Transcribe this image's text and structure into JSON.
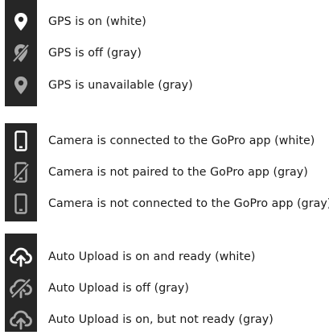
{
  "colors": {
    "icon_background": "#262626",
    "icon_white": "#ffffff",
    "icon_gray": "#a8a8a8",
    "text": "#1a1a1a"
  },
  "gps": {
    "items": [
      {
        "icon": "location-pin-icon",
        "label": "GPS is on (white)"
      },
      {
        "icon": "location-pin-off-icon",
        "label": "GPS is off (gray)"
      },
      {
        "icon": "location-pin-icon",
        "label": "GPS is unavailable (gray)"
      }
    ]
  },
  "app": {
    "items": [
      {
        "icon": "phone-icon",
        "label": "Camera is connected to the GoPro app (white)"
      },
      {
        "icon": "phone-off-icon",
        "label": "Camera is not paired to the GoPro app (gray)"
      },
      {
        "icon": "phone-icon",
        "label": "Camera is not connected to the GoPro app (gray)"
      }
    ]
  },
  "upload": {
    "items": [
      {
        "icon": "cloud-upload-icon",
        "label": "Auto Upload is on and ready (white)"
      },
      {
        "icon": "cloud-upload-off-icon",
        "label": "Auto Upload is off (gray)"
      },
      {
        "icon": "cloud-upload-icon",
        "label": "Auto Upload is on, but not ready (gray)"
      }
    ]
  }
}
